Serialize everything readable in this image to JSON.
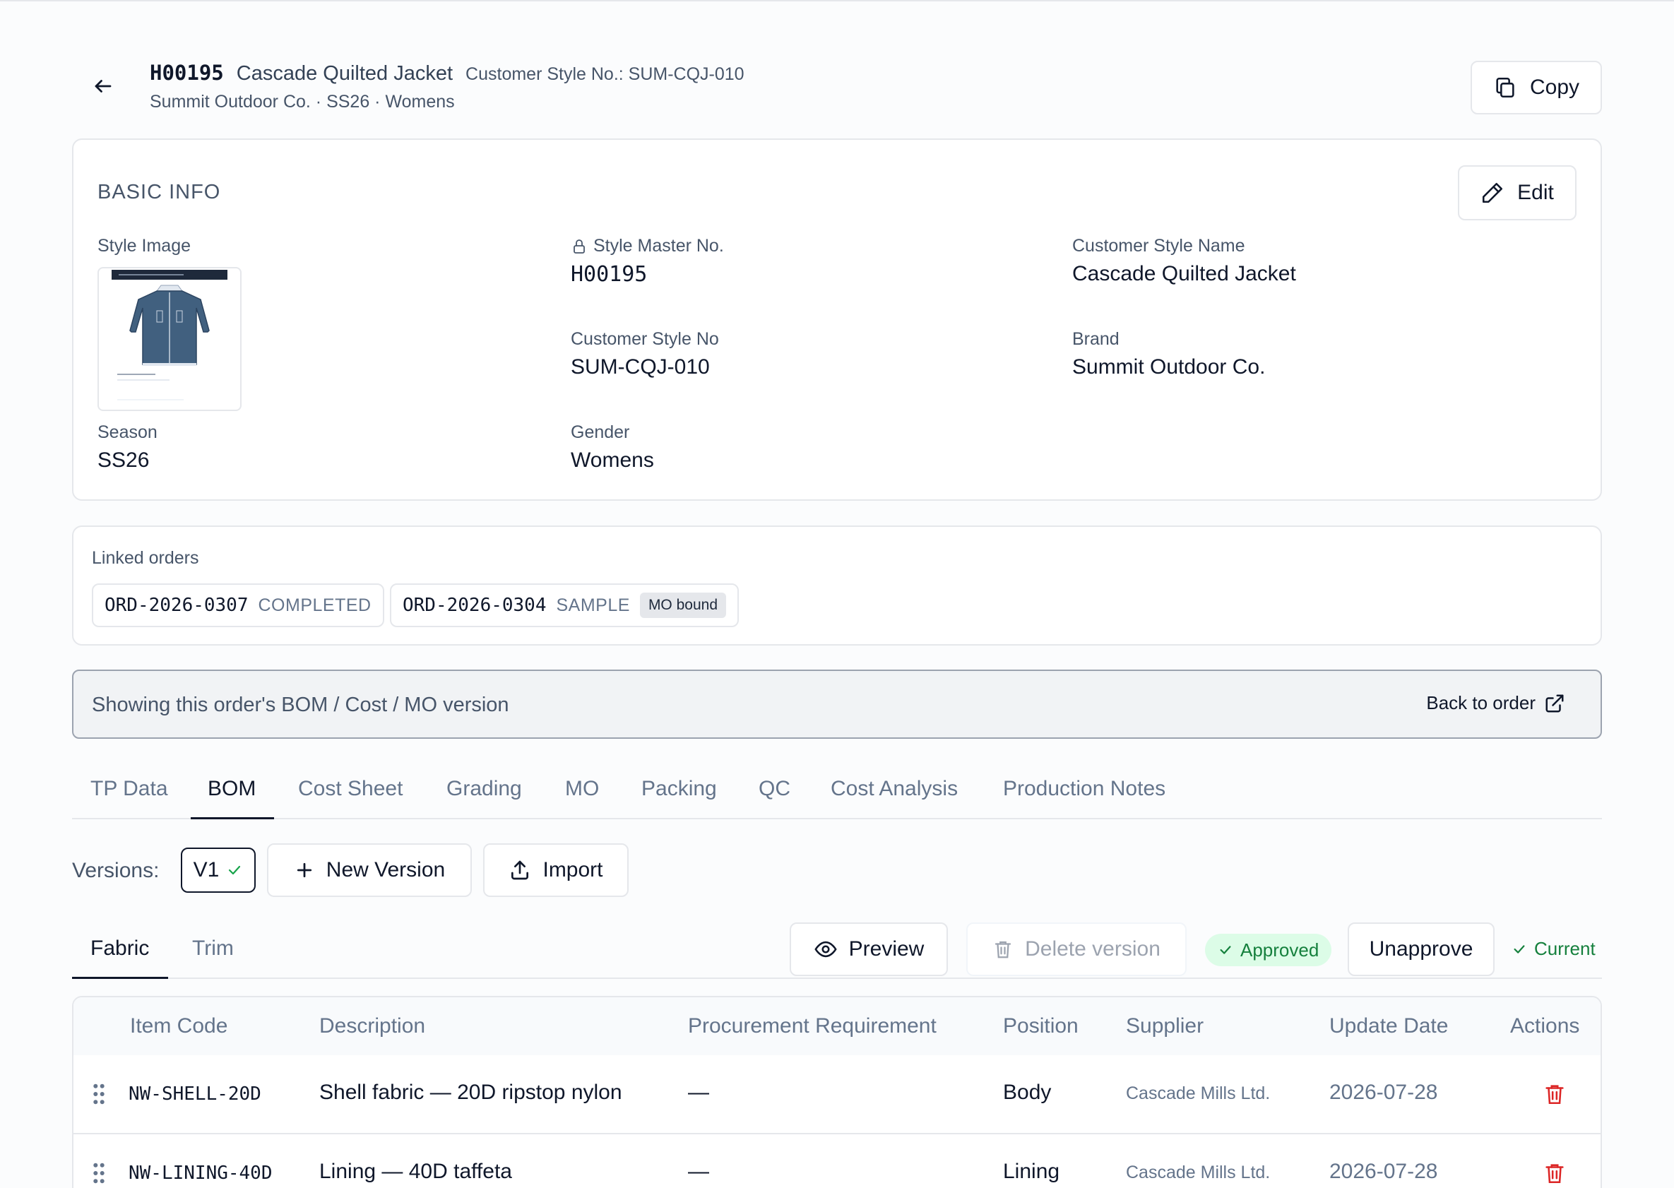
{
  "header": {
    "style_no": "H00195",
    "style_name": "Cascade Quilted Jacket",
    "customer_style_no": "Customer Style No.: SUM-CQJ-010",
    "subtitle": "Summit Outdoor Co. · SS26 · Womens",
    "copy_label": "Copy"
  },
  "basic_info": {
    "title": "BASIC INFO",
    "edit_label": "Edit",
    "style_image_label": "Style Image",
    "style_master_no_label": "Style Master No.",
    "style_master_no": "H00195",
    "customer_style_name_label": "Customer Style Name",
    "customer_style_name": "Cascade Quilted Jacket",
    "customer_style_no_label": "Customer Style No",
    "customer_style_no": "SUM-CQJ-010",
    "brand_label": "Brand",
    "brand": "Summit Outdoor Co.",
    "season_label": "Season",
    "season": "SS26",
    "gender_label": "Gender",
    "gender": "Womens",
    "image_caption": "PROTO — Front"
  },
  "linked_orders": {
    "title": "Linked orders",
    "orders": [
      {
        "id": "ORD-2026-0307",
        "status": "COMPLETED"
      },
      {
        "id": "ORD-2026-0304",
        "status": "SAMPLE",
        "badge": "MO bound"
      }
    ]
  },
  "banner": {
    "text": "Showing this order's BOM / Cost / MO version",
    "back_label": "Back to order"
  },
  "tabs": [
    "TP Data",
    "BOM",
    "Cost Sheet",
    "Grading",
    "MO",
    "Packing",
    "QC",
    "Cost Analysis",
    "Production Notes"
  ],
  "active_tab": "BOM",
  "versions": {
    "label": "Versions:",
    "current": "V1",
    "new_version_label": "New Version",
    "import_label": "Import"
  },
  "subtabs": [
    "Fabric",
    "Trim"
  ],
  "actions": {
    "preview_label": "Preview",
    "delete_label": "Delete version",
    "approved_label": "Approved",
    "unapprove_label": "Unapprove",
    "current_label": "Current"
  },
  "table": {
    "headers": [
      "Item Code",
      "Description",
      "Procurement Requirement",
      "Position",
      "Supplier",
      "Update Date",
      "Actions"
    ],
    "rows": [
      {
        "code": "NW-SHELL-20D",
        "description": "Shell fabric — 20D ripstop nylon",
        "procurement": "—",
        "position": "Body",
        "supplier": "Cascade Mills Ltd.",
        "date": "2026-07-28"
      },
      {
        "code": "NW-LINING-40D",
        "description": "Lining — 40D taffeta",
        "procurement": "—",
        "position": "Lining",
        "supplier": "Cascade Mills Ltd.",
        "date": "2026-07-28"
      }
    ]
  },
  "colors": {
    "accent": "#0f172a",
    "muted": "#64748b",
    "success_bg": "#dcfce7",
    "success_fg": "#15803d",
    "danger": "#dc2626"
  }
}
